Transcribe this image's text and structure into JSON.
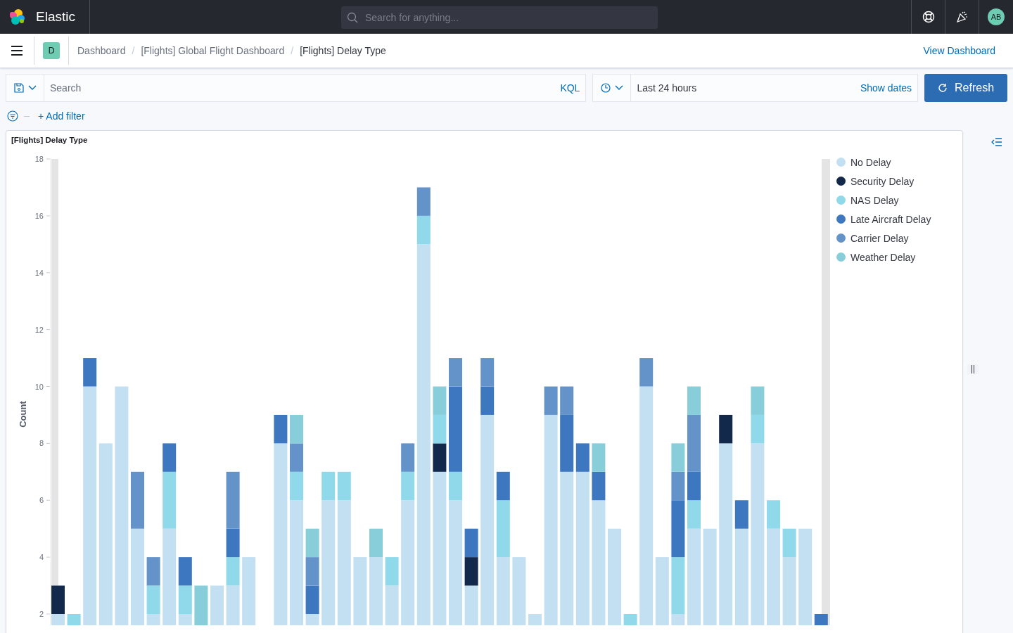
{
  "header": {
    "logo_text": "Elastic",
    "search": {
      "placeholder": "Search for anything..."
    },
    "avatar": "AB"
  },
  "nav": {
    "space_badge": "D",
    "separators": [
      "/",
      "/"
    ],
    "breadcrumbs": [
      {
        "label": "Dashboard",
        "current": false
      },
      {
        "label": "[Flights] Global Flight Dashboard",
        "current": false
      },
      {
        "label": "[Flights] Delay Type",
        "current": true
      }
    ],
    "view_link": "View Dashboard"
  },
  "query_bar": {
    "search": {
      "placeholder": "Search"
    },
    "language": "KQL",
    "time_range": "Last 24 hours",
    "show_dates": "Show dates",
    "refresh": "Refresh"
  },
  "filter_bar": {
    "add_filter": "+ Add filter"
  },
  "panel": {
    "title": "[Flights] Delay Type",
    "y_axis": {
      "title": "Count",
      "ticks": [
        "18",
        "16",
        "14",
        "12",
        "10",
        "8",
        "6",
        "4",
        "2"
      ]
    },
    "legend": [
      {
        "name": "No Delay",
        "color": "#c3dff2"
      },
      {
        "name": "Security Delay",
        "color": "#13294b"
      },
      {
        "name": "NAS Delay",
        "color": "#8fd9ea"
      },
      {
        "name": "Late Aircraft Delay",
        "color": "#3c77bf"
      },
      {
        "name": "Carrier Delay",
        "color": "#6393c9"
      },
      {
        "name": "Weather Delay",
        "color": "#87ceda"
      }
    ]
  }
}
